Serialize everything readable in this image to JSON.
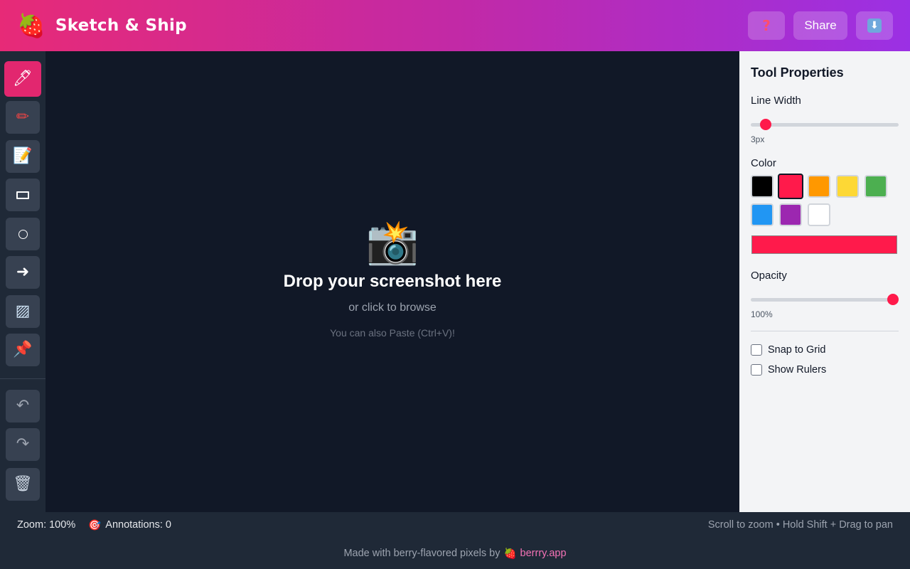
{
  "header": {
    "logo_icon": "strawberry-icon",
    "logo_glyph": "🍓",
    "title": "Sketch & Ship",
    "help_icon": "question-icon",
    "help_glyph": "?",
    "share_label": "Share",
    "download_icon": "download-icon",
    "download_glyph": "⬇"
  },
  "toolbar": {
    "tools": [
      {
        "name": "pen",
        "icon": "pen-icon",
        "glyph": "🖊",
        "active": true
      },
      {
        "name": "pencil",
        "icon": "pencil-icon",
        "glyph": "✏",
        "active": false
      },
      {
        "name": "text",
        "icon": "memo-icon",
        "glyph": "📝",
        "active": false
      },
      {
        "name": "rectangle",
        "icon": "rectangle-icon",
        "active": false
      },
      {
        "name": "circle",
        "icon": "circle-icon",
        "active": false
      },
      {
        "name": "arrow",
        "icon": "arrow-icon",
        "glyph": "➜",
        "active": false
      },
      {
        "name": "blur",
        "icon": "blur-icon",
        "glyph": "▨",
        "active": false
      },
      {
        "name": "pin",
        "icon": "pushpin-icon",
        "glyph": "📌",
        "active": false
      }
    ],
    "undo_icon": "undo-icon",
    "undo_glyph": "↶",
    "redo_icon": "redo-icon",
    "redo_glyph": "↷",
    "delete_icon": "trash-icon",
    "delete_glyph": "🗑"
  },
  "canvas": {
    "drop_icon": "camera-flash-icon",
    "drop_glyph": "📸",
    "drop_title": "Drop your screenshot here",
    "drop_subtitle": "or click to browse",
    "drop_hint": "You can also Paste (Ctrl+V)!"
  },
  "panel": {
    "title": "Tool Properties",
    "line_width_label": "Line Width",
    "line_width_value": "3px",
    "line_width_fraction": 0.07,
    "color_label": "Color",
    "swatches": [
      "#000000",
      "#ff1a4b",
      "#ff9800",
      "#fdd835",
      "#4caf50",
      "#2196f3",
      "#9c27b0",
      "#ffffff"
    ],
    "selected_color": "#ff1a4b",
    "opacity_label": "Opacity",
    "opacity_value": "100%",
    "opacity_fraction": 1.0,
    "snap_label": "Snap to Grid",
    "snap_checked": false,
    "rulers_label": "Show Rulers",
    "rulers_checked": false
  },
  "status": {
    "zoom_text": "Zoom: 100%",
    "annotations_icon": "target-icon",
    "annotations_glyph": "🎯",
    "annotations_text": "Annotations: 0",
    "hint": "Scroll to zoom • Hold Shift + Drag to pan"
  },
  "footer": {
    "text": "Made with berry-flavored pixels by",
    "berry_glyph": "🍓",
    "link_text": "berrry.app"
  },
  "colors": {
    "accent": "#e2276f",
    "header_gradient": [
      "#e72a77",
      "#9b30e4"
    ],
    "canvas_bg": "#111827",
    "panel_bg": "#f3f4f6"
  }
}
